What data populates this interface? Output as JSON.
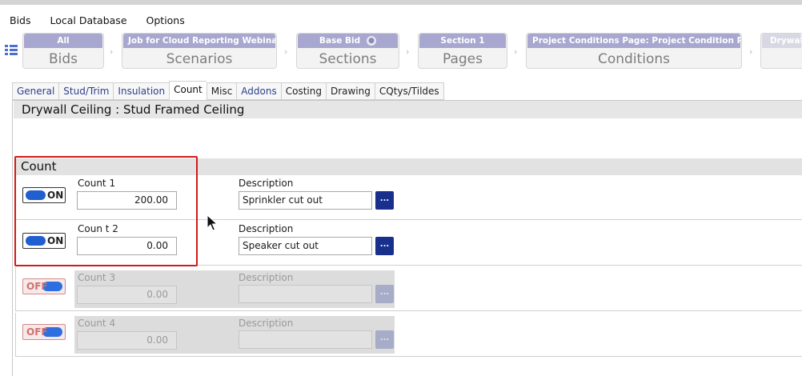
{
  "menu": {
    "items": [
      {
        "label": "Bids"
      },
      {
        "label": "Local Database"
      },
      {
        "label": "Options"
      }
    ]
  },
  "breadcrumbs": [
    {
      "head": "All",
      "big": "Bids"
    },
    {
      "head": "Job for Cloud Reporting Webinar",
      "big": "Scenarios"
    },
    {
      "head": "Base Bid",
      "big": "Sections"
    },
    {
      "head": "Section 1",
      "big": "Pages"
    },
    {
      "head": "Project Conditions Page: Project Condition Page",
      "big": "Conditions"
    },
    {
      "head": "Drywall",
      "big": ""
    }
  ],
  "tabs": [
    {
      "label": "General"
    },
    {
      "label": "Stud/Trim"
    },
    {
      "label": "Insulation"
    },
    {
      "label": "Count"
    },
    {
      "label": "Misc"
    },
    {
      "label": "Addons"
    },
    {
      "label": "Costing"
    },
    {
      "label": "Drawing"
    },
    {
      "label": "CQtys/Tildes"
    }
  ],
  "active_tab": "Count",
  "pane": {
    "title": "Drywall Ceiling : Stud Framed Ceiling",
    "section_title": "Count"
  },
  "counts": [
    {
      "toggle": "ON",
      "label": "Count 1",
      "value": "200.00",
      "desc_label": "Description",
      "description": "Sprinkler cut out",
      "button": "...",
      "enabled": true
    },
    {
      "toggle": "ON",
      "label": "Coun t 2",
      "value": "0.00",
      "desc_label": "Description",
      "description": "Speaker cut out",
      "button": "...",
      "enabled": true
    },
    {
      "toggle": "OFF",
      "label": "Count 3",
      "value": "0.00",
      "desc_label": "Description",
      "description": "",
      "button": "...",
      "enabled": false
    },
    {
      "toggle": "OFF",
      "label": "Count 4",
      "value": "0.00",
      "desc_label": "Description",
      "description": "",
      "button": "...",
      "enabled": false
    }
  ],
  "colors": {
    "breadcrumb_header": "#a7a7cf",
    "toggle_knob": "#1f5fd0",
    "ellipsis_button": "#18308c",
    "highlight_box": "#d11a1a"
  }
}
